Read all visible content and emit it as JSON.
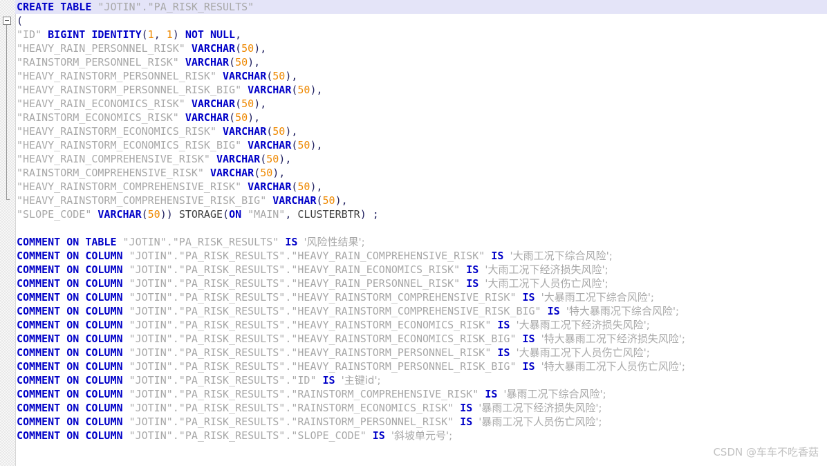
{
  "editor": {
    "title": "SQL Editor",
    "schema": "JOTIN",
    "table": "PA_RISK_RESULTS",
    "current_line_index": 0,
    "colors": {
      "keyword": "#0000c8",
      "identifier": "#a8a8a8",
      "number": "#ee8800",
      "string": "#a8a8a8",
      "punctuation": "#202060",
      "current_line_background": "#e4e4f8",
      "background": "#ffffff",
      "gutter_background": "#f0f0f0",
      "watermark": "#c2c2c2"
    }
  },
  "gutter": {
    "fold_icon": "fold-collapse-minus-icon",
    "fold_state": "expanded"
  },
  "watermark": {
    "text": "CSDN @车车不吃香菇"
  },
  "lines": [
    {
      "index": 0,
      "current": true,
      "tokens": [
        {
          "t": "CREATE TABLE ",
          "c": "kw"
        },
        {
          "t": "\"JOTIN\".\"PA_RISK_RESULTS\"",
          "c": "ident"
        }
      ]
    },
    {
      "index": 1,
      "tokens": [
        {
          "t": "(",
          "c": "punc"
        }
      ]
    },
    {
      "index": 2,
      "tokens": [
        {
          "t": "\"ID\" ",
          "c": "ident"
        },
        {
          "t": "BIGINT IDENTITY",
          "c": "kw"
        },
        {
          "t": "(",
          "c": "punc"
        },
        {
          "t": "1",
          "c": "num"
        },
        {
          "t": ", ",
          "c": "punc"
        },
        {
          "t": "1",
          "c": "num"
        },
        {
          "t": ") ",
          "c": "punc"
        },
        {
          "t": "NOT NULL",
          "c": "kw"
        },
        {
          "t": ",",
          "c": "punc"
        }
      ]
    },
    {
      "index": 3,
      "tokens": [
        {
          "t": "\"HEAVY_RAIN_PERSONNEL_RISK\" ",
          "c": "ident"
        },
        {
          "t": "VARCHAR",
          "c": "type"
        },
        {
          "t": "(",
          "c": "punc"
        },
        {
          "t": "50",
          "c": "num"
        },
        {
          "t": "),",
          "c": "punc"
        }
      ]
    },
    {
      "index": 4,
      "tokens": [
        {
          "t": "\"RAINSTORM_PERSONNEL_RISK\" ",
          "c": "ident"
        },
        {
          "t": "VARCHAR",
          "c": "type"
        },
        {
          "t": "(",
          "c": "punc"
        },
        {
          "t": "50",
          "c": "num"
        },
        {
          "t": "),",
          "c": "punc"
        }
      ]
    },
    {
      "index": 5,
      "tokens": [
        {
          "t": "\"HEAVY_RAINSTORM_PERSONNEL_RISK\" ",
          "c": "ident"
        },
        {
          "t": "VARCHAR",
          "c": "type"
        },
        {
          "t": "(",
          "c": "punc"
        },
        {
          "t": "50",
          "c": "num"
        },
        {
          "t": "),",
          "c": "punc"
        }
      ]
    },
    {
      "index": 6,
      "tokens": [
        {
          "t": "\"HEAVY_RAINSTORM_PERSONNEL_RISK_BIG\" ",
          "c": "ident"
        },
        {
          "t": "VARCHAR",
          "c": "type"
        },
        {
          "t": "(",
          "c": "punc"
        },
        {
          "t": "50",
          "c": "num"
        },
        {
          "t": "),",
          "c": "punc"
        }
      ]
    },
    {
      "index": 7,
      "tokens": [
        {
          "t": "\"HEAVY_RAIN_ECONOMICS_RISK\" ",
          "c": "ident"
        },
        {
          "t": "VARCHAR",
          "c": "type"
        },
        {
          "t": "(",
          "c": "punc"
        },
        {
          "t": "50",
          "c": "num"
        },
        {
          "t": "),",
          "c": "punc"
        }
      ]
    },
    {
      "index": 8,
      "tokens": [
        {
          "t": "\"RAINSTORM_ECONOMICS_RISK\" ",
          "c": "ident"
        },
        {
          "t": "VARCHAR",
          "c": "type"
        },
        {
          "t": "(",
          "c": "punc"
        },
        {
          "t": "50",
          "c": "num"
        },
        {
          "t": "),",
          "c": "punc"
        }
      ]
    },
    {
      "index": 9,
      "tokens": [
        {
          "t": "\"HEAVY_RAINSTORM_ECONOMICS_RISK\" ",
          "c": "ident"
        },
        {
          "t": "VARCHAR",
          "c": "type"
        },
        {
          "t": "(",
          "c": "punc"
        },
        {
          "t": "50",
          "c": "num"
        },
        {
          "t": "),",
          "c": "punc"
        }
      ]
    },
    {
      "index": 10,
      "tokens": [
        {
          "t": "\"HEAVY_RAINSTORM_ECONOMICS_RISK_BIG\" ",
          "c": "ident"
        },
        {
          "t": "VARCHAR",
          "c": "type"
        },
        {
          "t": "(",
          "c": "punc"
        },
        {
          "t": "50",
          "c": "num"
        },
        {
          "t": "),",
          "c": "punc"
        }
      ]
    },
    {
      "index": 11,
      "tokens": [
        {
          "t": "\"HEAVY_RAIN_COMPREHENSIVE_RISK\" ",
          "c": "ident"
        },
        {
          "t": "VARCHAR",
          "c": "type"
        },
        {
          "t": "(",
          "c": "punc"
        },
        {
          "t": "50",
          "c": "num"
        },
        {
          "t": "),",
          "c": "punc"
        }
      ]
    },
    {
      "index": 12,
      "tokens": [
        {
          "t": "\"RAINSTORM_COMPREHENSIVE_RISK\" ",
          "c": "ident"
        },
        {
          "t": "VARCHAR",
          "c": "type"
        },
        {
          "t": "(",
          "c": "punc"
        },
        {
          "t": "50",
          "c": "num"
        },
        {
          "t": "),",
          "c": "punc"
        }
      ]
    },
    {
      "index": 13,
      "tokens": [
        {
          "t": "\"HEAVY_RAINSTORM_COMPREHENSIVE_RISK\" ",
          "c": "ident"
        },
        {
          "t": "VARCHAR",
          "c": "type"
        },
        {
          "t": "(",
          "c": "punc"
        },
        {
          "t": "50",
          "c": "num"
        },
        {
          "t": "),",
          "c": "punc"
        }
      ]
    },
    {
      "index": 14,
      "tokens": [
        {
          "t": "\"HEAVY_RAINSTORM_COMPREHENSIVE_RISK_BIG\" ",
          "c": "ident"
        },
        {
          "t": "VARCHAR",
          "c": "type"
        },
        {
          "t": "(",
          "c": "punc"
        },
        {
          "t": "50",
          "c": "num"
        },
        {
          "t": "),",
          "c": "punc"
        }
      ]
    },
    {
      "index": 15,
      "tokens": [
        {
          "t": "\"SLOPE_CODE\" ",
          "c": "ident"
        },
        {
          "t": "VARCHAR",
          "c": "type"
        },
        {
          "t": "(",
          "c": "punc"
        },
        {
          "t": "50",
          "c": "num"
        },
        {
          "t": ")) ",
          "c": "punc"
        },
        {
          "t": "STORAGE",
          "c": "plain"
        },
        {
          "t": "(",
          "c": "punc"
        },
        {
          "t": "ON",
          "c": "kw"
        },
        {
          "t": " ",
          "c": "plain"
        },
        {
          "t": "\"MAIN\"",
          "c": "ident"
        },
        {
          "t": ", ",
          "c": "punc"
        },
        {
          "t": "CLUSTERBTR",
          "c": "plain"
        },
        {
          "t": ") ;",
          "c": "punc"
        }
      ]
    },
    {
      "index": 16,
      "blank": true,
      "tokens": []
    },
    {
      "index": 17,
      "tokens": [
        {
          "t": "COMMENT ON TABLE ",
          "c": "kw"
        },
        {
          "t": "\"JOTIN\".\"PA_RISK_RESULTS\" ",
          "c": "ident"
        },
        {
          "t": "IS ",
          "c": "kw"
        },
        {
          "t": "'风险性结果';",
          "c": "cjk"
        }
      ]
    },
    {
      "index": 18,
      "tokens": [
        {
          "t": "COMMENT ON COLUMN ",
          "c": "kw"
        },
        {
          "t": "\"JOTIN\".\"PA_RISK_RESULTS\".\"HEAVY_RAIN_COMPREHENSIVE_RISK\" ",
          "c": "ident"
        },
        {
          "t": "IS ",
          "c": "kw"
        },
        {
          "t": "'大雨工况下综合风险';",
          "c": "cjk"
        }
      ]
    },
    {
      "index": 19,
      "tokens": [
        {
          "t": "COMMENT ON COLUMN ",
          "c": "kw"
        },
        {
          "t": "\"JOTIN\".\"PA_RISK_RESULTS\".\"HEAVY_RAIN_ECONOMICS_RISK\" ",
          "c": "ident"
        },
        {
          "t": "IS ",
          "c": "kw"
        },
        {
          "t": "'大雨工况下经济损失风险';",
          "c": "cjk"
        }
      ]
    },
    {
      "index": 20,
      "tokens": [
        {
          "t": "COMMENT ON COLUMN ",
          "c": "kw"
        },
        {
          "t": "\"JOTIN\".\"PA_RISK_RESULTS\".\"HEAVY_RAIN_PERSONNEL_RISK\" ",
          "c": "ident"
        },
        {
          "t": "IS ",
          "c": "kw"
        },
        {
          "t": "'大雨工况下人员伤亡风险';",
          "c": "cjk"
        }
      ]
    },
    {
      "index": 21,
      "tokens": [
        {
          "t": "COMMENT ON COLUMN ",
          "c": "kw"
        },
        {
          "t": "\"JOTIN\".\"PA_RISK_RESULTS\".\"HEAVY_RAINSTORM_COMPREHENSIVE_RISK\" ",
          "c": "ident"
        },
        {
          "t": "IS ",
          "c": "kw"
        },
        {
          "t": "'大暴雨工况下综合风险';",
          "c": "cjk"
        }
      ]
    },
    {
      "index": 22,
      "tokens": [
        {
          "t": "COMMENT ON COLUMN ",
          "c": "kw"
        },
        {
          "t": "\"JOTIN\".\"PA_RISK_RESULTS\".\"HEAVY_RAINSTORM_COMPREHENSIVE_RISK_BIG\" ",
          "c": "ident"
        },
        {
          "t": "IS ",
          "c": "kw"
        },
        {
          "t": "'特大暴雨况下综合风险';",
          "c": "cjk"
        }
      ]
    },
    {
      "index": 23,
      "tokens": [
        {
          "t": "COMMENT ON COLUMN ",
          "c": "kw"
        },
        {
          "t": "\"JOTIN\".\"PA_RISK_RESULTS\".\"HEAVY_RAINSTORM_ECONOMICS_RISK\" ",
          "c": "ident"
        },
        {
          "t": "IS ",
          "c": "kw"
        },
        {
          "t": "'大暴雨工况下经济损失风险';",
          "c": "cjk"
        }
      ]
    },
    {
      "index": 24,
      "tokens": [
        {
          "t": "COMMENT ON COLUMN ",
          "c": "kw"
        },
        {
          "t": "\"JOTIN\".\"PA_RISK_RESULTS\".\"HEAVY_RAINSTORM_ECONOMICS_RISK_BIG\" ",
          "c": "ident"
        },
        {
          "t": "IS ",
          "c": "kw"
        },
        {
          "t": "'特大暴雨工况下经济损失风险';",
          "c": "cjk"
        }
      ]
    },
    {
      "index": 25,
      "tokens": [
        {
          "t": "COMMENT ON COLUMN ",
          "c": "kw"
        },
        {
          "t": "\"JOTIN\".\"PA_RISK_RESULTS\".\"HEAVY_RAINSTORM_PERSONNEL_RISK\" ",
          "c": "ident"
        },
        {
          "t": "IS ",
          "c": "kw"
        },
        {
          "t": "'大暴雨工况下人员伤亡风险';",
          "c": "cjk"
        }
      ]
    },
    {
      "index": 26,
      "tokens": [
        {
          "t": "COMMENT ON COLUMN ",
          "c": "kw"
        },
        {
          "t": "\"JOTIN\".\"PA_RISK_RESULTS\".\"HEAVY_RAINSTORM_PERSONNEL_RISK_BIG\" ",
          "c": "ident"
        },
        {
          "t": "IS ",
          "c": "kw"
        },
        {
          "t": "'特大暴雨工况下人员伤亡风险';",
          "c": "cjk"
        }
      ]
    },
    {
      "index": 27,
      "tokens": [
        {
          "t": "COMMENT ON COLUMN ",
          "c": "kw"
        },
        {
          "t": "\"JOTIN\".\"PA_RISK_RESULTS\".\"ID\" ",
          "c": "ident"
        },
        {
          "t": "IS ",
          "c": "kw"
        },
        {
          "t": "'主键id';",
          "c": "cjk"
        }
      ]
    },
    {
      "index": 28,
      "tokens": [
        {
          "t": "COMMENT ON COLUMN ",
          "c": "kw"
        },
        {
          "t": "\"JOTIN\".\"PA_RISK_RESULTS\".\"RAINSTORM_COMPREHENSIVE_RISK\" ",
          "c": "ident"
        },
        {
          "t": "IS ",
          "c": "kw"
        },
        {
          "t": "'暴雨工况下综合风险';",
          "c": "cjk"
        }
      ]
    },
    {
      "index": 29,
      "tokens": [
        {
          "t": "COMMENT ON COLUMN ",
          "c": "kw"
        },
        {
          "t": "\"JOTIN\".\"PA_RISK_RESULTS\".\"RAINSTORM_ECONOMICS_RISK\" ",
          "c": "ident"
        },
        {
          "t": "IS ",
          "c": "kw"
        },
        {
          "t": "'暴雨工况下经济损失风险';",
          "c": "cjk"
        }
      ]
    },
    {
      "index": 30,
      "tokens": [
        {
          "t": "COMMENT ON COLUMN ",
          "c": "kw"
        },
        {
          "t": "\"JOTIN\".\"PA_RISK_RESULTS\".\"RAINSTORM_PERSONNEL_RISK\" ",
          "c": "ident"
        },
        {
          "t": "IS ",
          "c": "kw"
        },
        {
          "t": "'暴雨工况下人员伤亡风险';",
          "c": "cjk"
        }
      ]
    },
    {
      "index": 31,
      "tokens": [
        {
          "t": "COMMENT ON COLUMN ",
          "c": "kw"
        },
        {
          "t": "\"JOTIN\".\"PA_RISK_RESULTS\".\"SLOPE_CODE\" ",
          "c": "ident"
        },
        {
          "t": "IS ",
          "c": "kw"
        },
        {
          "t": "'斜坡单元号';",
          "c": "cjk"
        }
      ]
    }
  ]
}
